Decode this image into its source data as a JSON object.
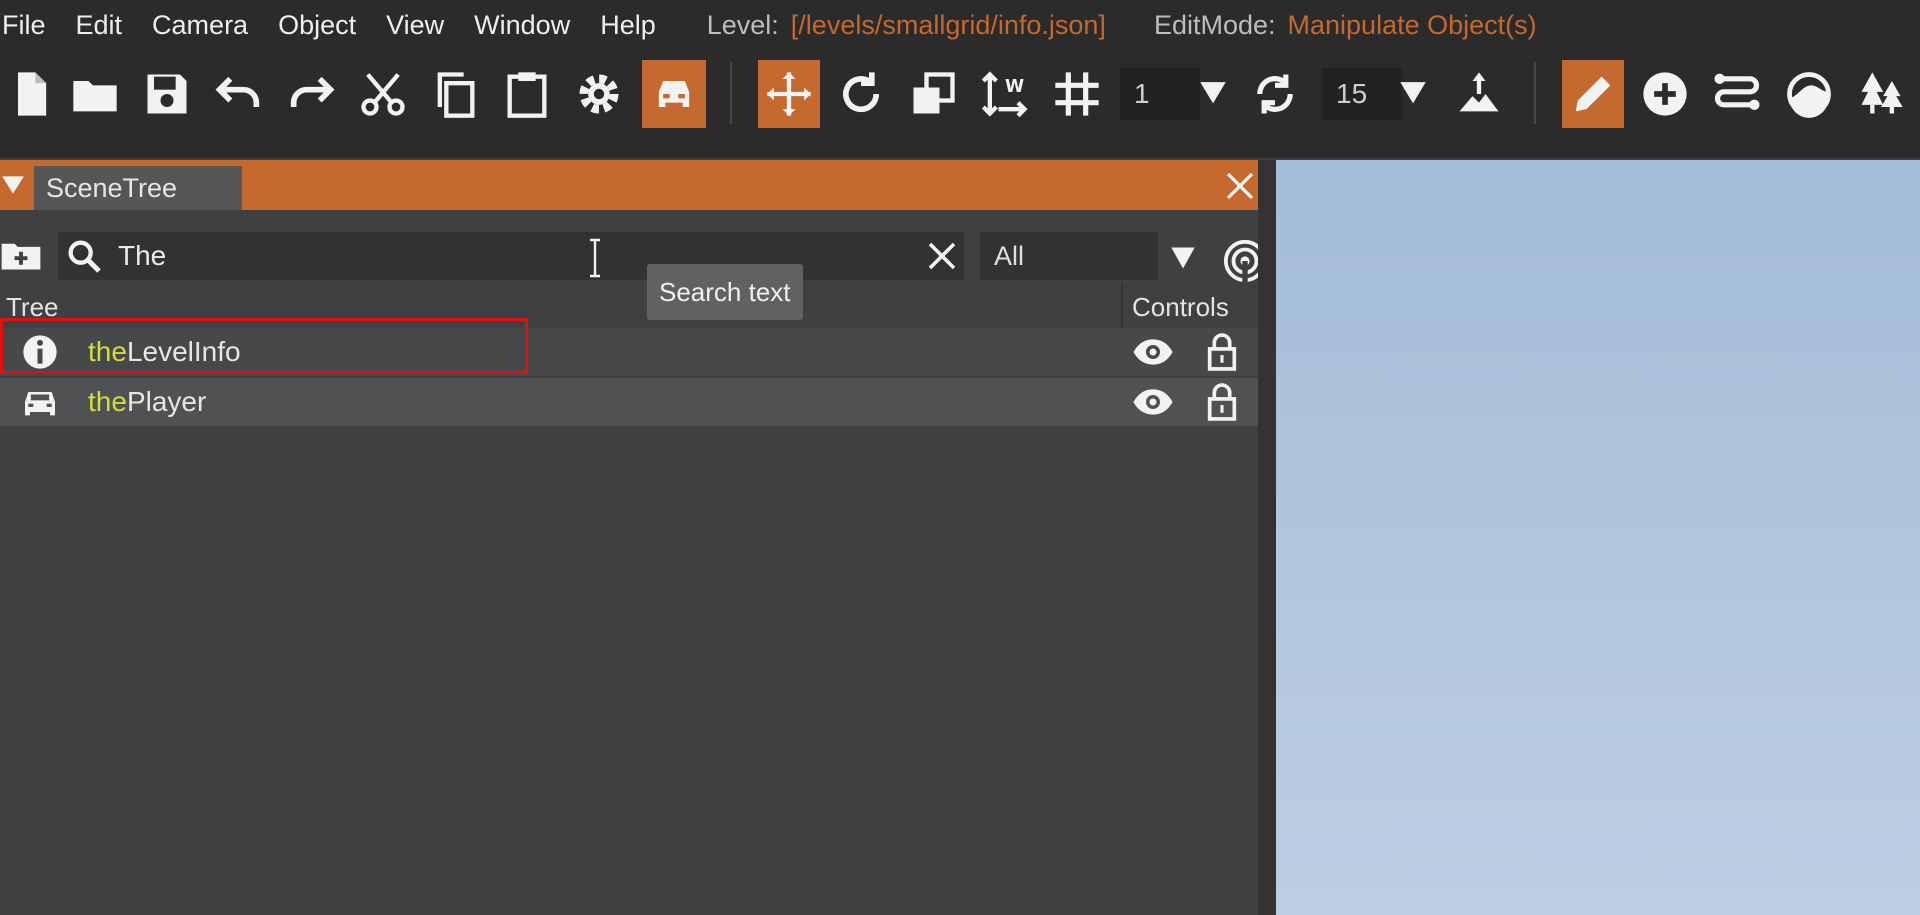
{
  "menubar": {
    "items": [
      "File",
      "Edit",
      "Camera",
      "Object",
      "View",
      "Window",
      "Help"
    ],
    "level_label": "Level:",
    "level_value": "[/levels/smallgrid/info.json]",
    "editmode_label": "EditMode:",
    "editmode_value": "Manipulate Object(s)"
  },
  "toolbar": {
    "grid_size_value": "1",
    "rotation_snap_value": "15",
    "accent_color": "#c4692f"
  },
  "scene_tree": {
    "tab_title": "SceneTree",
    "search": {
      "value": "The"
    },
    "filter": {
      "selected": "All"
    },
    "tooltip": "Search text",
    "columns": {
      "tree": "Tree",
      "controls": "Controls"
    },
    "rows": [
      {
        "icon": "info-icon",
        "match": "the",
        "rest": "LevelInfo"
      },
      {
        "icon": "car-icon",
        "match": "the",
        "rest": "Player"
      }
    ]
  },
  "colors": {
    "panel_header": "#c5692f",
    "match_highlight": "#d4dc3a",
    "selection_outline": "#e01010"
  }
}
